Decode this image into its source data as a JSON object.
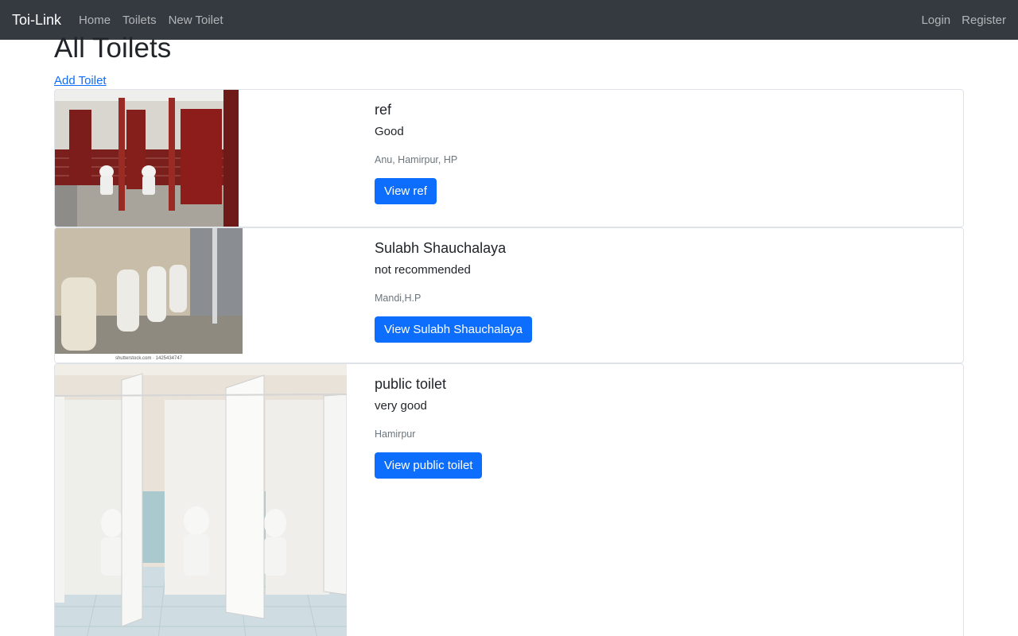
{
  "navbar": {
    "brand": "Toi-Link",
    "links": [
      "Home",
      "Toilets",
      "New Toilet"
    ],
    "right_links": [
      "Login",
      "Register"
    ],
    "bg_color": "#343a40"
  },
  "page": {
    "title": "All Toilets",
    "add_link": "Add Toilet"
  },
  "toilets": [
    {
      "name": "ref",
      "description": "Good",
      "location": "Anu, Hamirpur, HP",
      "button": "View ref"
    },
    {
      "name": "Sulabh Shauchalaya",
      "description": "not recommended",
      "location": "Mandi,H.P",
      "button": "View Sulabh Shauchalaya",
      "image_caption": "shutterstock.com · 1425434747"
    },
    {
      "name": "public toilet",
      "description": "very good",
      "location": "Hamirpur",
      "button": "View public toilet"
    }
  ],
  "colors": {
    "primary": "#0d6efd",
    "muted": "#6c757d"
  }
}
